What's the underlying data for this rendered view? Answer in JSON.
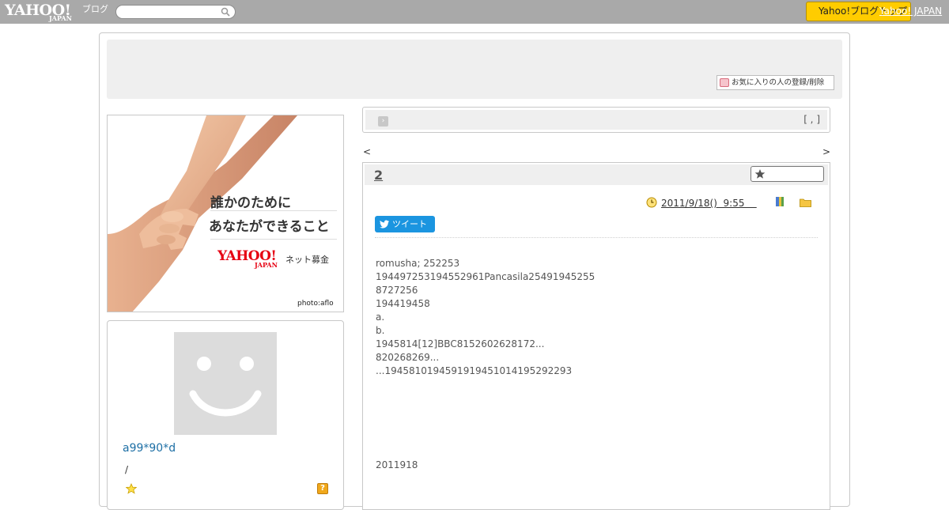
{
  "topbar": {
    "logo_main": "YAHOO!",
    "logo_sub": "JAPAN",
    "logo_blog": "ブログ",
    "search_placeholder": "",
    "button_label": "Yahoo!ブログトップ",
    "top_link": "Yahoo! JAPAN"
  },
  "header": {
    "fav_button": "お気に入りの人の登録/削除"
  },
  "banner": {
    "line1": "誰かのために",
    "line2": "あなたができること",
    "logo": "YAHOO!",
    "logo_sub": "JAPAN",
    "net": "ネット募金",
    "credit": "photo:aflo"
  },
  "profile": {
    "nickname": "a99*90*d",
    "slash": "/"
  },
  "theme": {
    "count": "[ , ]"
  },
  "nav": {
    "prev": "<",
    "next": ">"
  },
  "article": {
    "title": "2",
    "date": "2011/9/18()  9:55    ",
    "tweet_label": "ツイート",
    "lines": [
      "romusha; 252253",
      "194497253194552961Pancasila25491945255",
      "8727256",
      "194419458",
      "a.",
      "b.",
      "1945814[12]BBC8152602628172...",
      "820268269...",
      "...194581019459191945101419529229­3"
    ],
    "footer_date": "2011918"
  }
}
